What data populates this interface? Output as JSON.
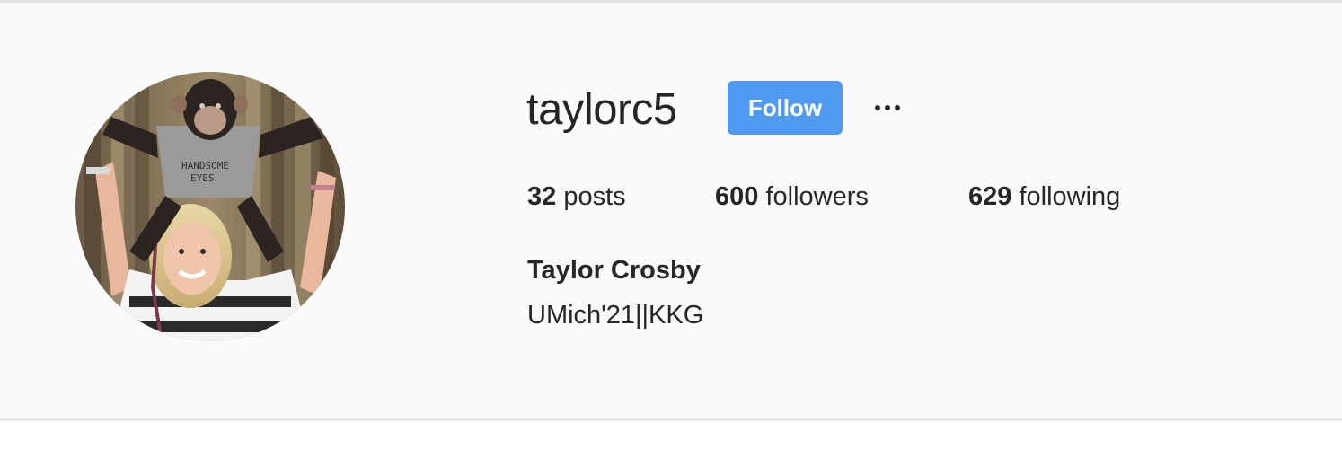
{
  "profile": {
    "username": "taylorc5",
    "follow_label": "Follow",
    "more_label": "...",
    "full_name": "Taylor Crosby",
    "bio": "UMich'21||KKG"
  },
  "stats": {
    "posts_count": "32",
    "posts_label": "posts",
    "followers_count": "600",
    "followers_label": "followers",
    "following_count": "629",
    "following_label": "following"
  },
  "colors": {
    "follow_button": "#4f9af0",
    "background": "#fafafa",
    "text": "#262626"
  },
  "icons": {
    "more": "more-options-icon"
  }
}
